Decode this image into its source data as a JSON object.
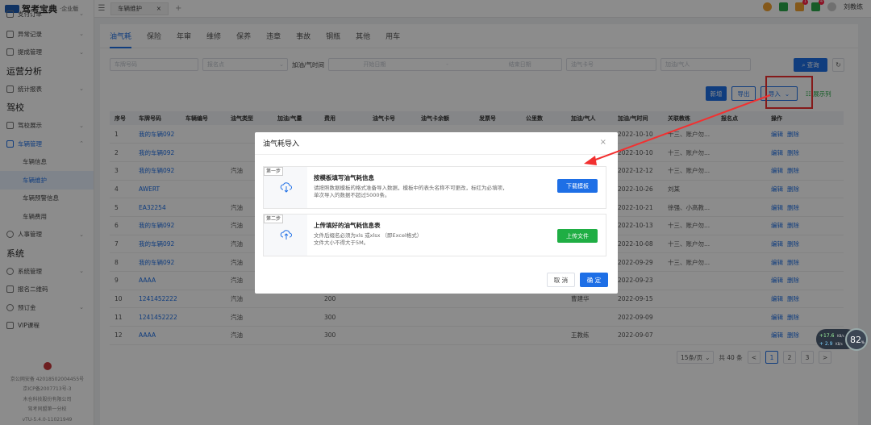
{
  "app": {
    "logo_text": "驾考宝典",
    "logo_sub": "·企业版"
  },
  "sidebar": {
    "items_top": [
      {
        "label": "支付订单"
      },
      {
        "label": "异常记录"
      },
      {
        "label": "提成管理"
      }
    ],
    "group_ops": "运营分析",
    "stats": "统计报表",
    "group_school": "驾校",
    "school_show": "驾校展示",
    "vehicle_mgmt": "车辆管理",
    "vehicle_subs": [
      {
        "label": "车辆信息"
      },
      {
        "label": "车辆维护"
      },
      {
        "label": "车辆预警信息"
      },
      {
        "label": "车辆费用"
      }
    ],
    "hr": "人事管理",
    "group_system": "系统",
    "sys_mgmt": "系统管理",
    "qr": "报名二维码",
    "prepay": "预订金",
    "vip": "VIP课程",
    "footer": [
      "京公网安备 42018502004455号",
      "京ICP备2007713号-3",
      "木仓科技股份有限公司",
      "驾考同盟第一分校",
      "vTU-5.4.0-11021949"
    ]
  },
  "topbar": {
    "tab": "车辆维护",
    "tab_close": "×",
    "add": "+",
    "badge1": "1",
    "badge2": "4",
    "username": "刘教练"
  },
  "subtabs": [
    "油气耗",
    "保险",
    "年审",
    "维修",
    "保养",
    "违章",
    "事故",
    "钢瓶",
    "其他",
    "用车"
  ],
  "filters": {
    "plate": "车牌号码",
    "name": "报名点",
    "time_label": "加油/气时间",
    "start": "开始日期",
    "sep": "-",
    "end": "结束日期",
    "card": "油气卡号",
    "person": "加油/气人",
    "query": "查询",
    "refresh": "↻"
  },
  "actions": {
    "add": "新增",
    "export": "导出",
    "import": "导入",
    "showcol": "展示列"
  },
  "table": {
    "headers": [
      "序号",
      "车牌号码",
      "车辆编号",
      "油气类型",
      "加油/气量",
      "费用",
      "油气卡号",
      "油气卡余额",
      "发票号",
      "公里数",
      "加油/气人",
      "加油/气时间",
      "关联教练",
      "报名点",
      "操作"
    ],
    "rows": [
      {
        "n": "1",
        "plate": "我的车辆092",
        "type": "",
        "fee": "",
        "person": "",
        "time": "2022-10-10",
        "coach": "十三、账户勿..."
      },
      {
        "n": "2",
        "plate": "我的车辆092",
        "type": "",
        "fee": "",
        "person": "",
        "time": "2022-10-10",
        "coach": "十三、账户勿..."
      },
      {
        "n": "3",
        "plate": "我的车辆092",
        "type": "汽油",
        "fee": "",
        "person": "",
        "time": "2022-12-12",
        "coach": "十三、账户勿..."
      },
      {
        "n": "4",
        "plate": "AWERT",
        "type": "",
        "fee": "",
        "person": "...",
        "time": "2022-10-26",
        "coach": "刘某"
      },
      {
        "n": "5",
        "plate": "EA32254",
        "type": "汽油",
        "fee": "",
        "person": "",
        "time": "2022-10-21",
        "coach": "徐强、小高教..."
      },
      {
        "n": "6",
        "plate": "我的车辆092",
        "type": "汽油",
        "fee": "",
        "person": "",
        "time": "2022-10-13",
        "coach": "十三、账户勿..."
      },
      {
        "n": "7",
        "plate": "我的车辆092",
        "type": "汽油",
        "fee": "",
        "person": "",
        "time": "2022-10-08",
        "coach": "十三、账户勿..."
      },
      {
        "n": "8",
        "plate": "我的车辆092",
        "type": "汽油",
        "fee": "",
        "person": "",
        "time": "2022-09-29",
        "coach": "十三、账户勿..."
      },
      {
        "n": "9",
        "plate": "AAAA",
        "type": "汽油",
        "fee": "",
        "person": "",
        "time": "2022-09-23",
        "coach": ""
      },
      {
        "n": "10",
        "plate": "1241452222",
        "type": "汽油",
        "fee": "200",
        "person": "曹建华",
        "time": "2022-09-15",
        "coach": ""
      },
      {
        "n": "11",
        "plate": "1241452222",
        "type": "汽油",
        "fee": "300",
        "person": "",
        "time": "2022-09-09",
        "coach": ""
      },
      {
        "n": "12",
        "plate": "AAAA",
        "type": "汽油",
        "fee": "300",
        "person": "王教练",
        "time": "2022-09-07",
        "coach": ""
      }
    ],
    "op_edit": "编辑",
    "op_del": "删除"
  },
  "pager": {
    "size": "15条/页",
    "total": "共 40 条",
    "prev": "<",
    "pages": [
      "1",
      "2",
      "3"
    ],
    "next": ">"
  },
  "modal": {
    "title": "油气耗导入",
    "close": "×",
    "step1_tag": "第一步",
    "step1_title": "按模板填写油气耗信息",
    "step1_desc1": "请按照数据模板的格式准备导入数据，模板中的表头名称不可更改，标红为必填项，",
    "step1_desc2": "单次导入的数据不超过5000条。",
    "step1_btn": "下载模板",
    "step2_tag": "第二步",
    "step2_title": "上传填好的油气耗信息表",
    "step2_desc1": "文件后缀名必须为xls 或xlsx （即Excel格式）",
    "step2_desc2": "文件大小不得大于5M。",
    "step2_btn": "上传文件",
    "cancel": "取 消",
    "ok": "确 定"
  },
  "speed": {
    "up": "+17.6",
    "down": "+ 2.9",
    "unit": "KB/s",
    "pct": "82",
    "pct_unit": "%"
  },
  "colors": {
    "primary": "#1e6fe6",
    "green": "#1fae44",
    "red": "#f23030"
  }
}
